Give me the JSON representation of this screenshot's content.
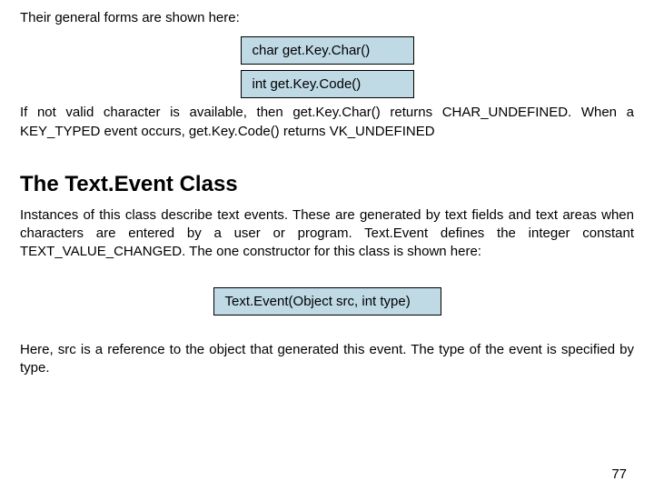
{
  "intro": "Their general forms are shown here:",
  "codebox1": "char get.Key.Char()",
  "codebox2": "int get.Key.Code()",
  "para_after_boxes": "If not valid character is available, then get.Key.Char() returns CHAR_UNDEFINED. When a KEY_TYPED event occurs, get.Key.Code() returns VK_UNDEFINED",
  "heading": "The Text.Event Class",
  "textevent_para": "Instances of this class describe text events. These are generated by text fields and text areas when characters are entered by a user or program. Text.Event defines the integer constant TEXT_VALUE_CHANGED. The one constructor for this class is shown here:",
  "codebox3": "Text.Event(Object src, int type)",
  "closing_para": "Here, src is a reference to the object that generated this event. The type of the event is specified by type.",
  "page_number": "77"
}
